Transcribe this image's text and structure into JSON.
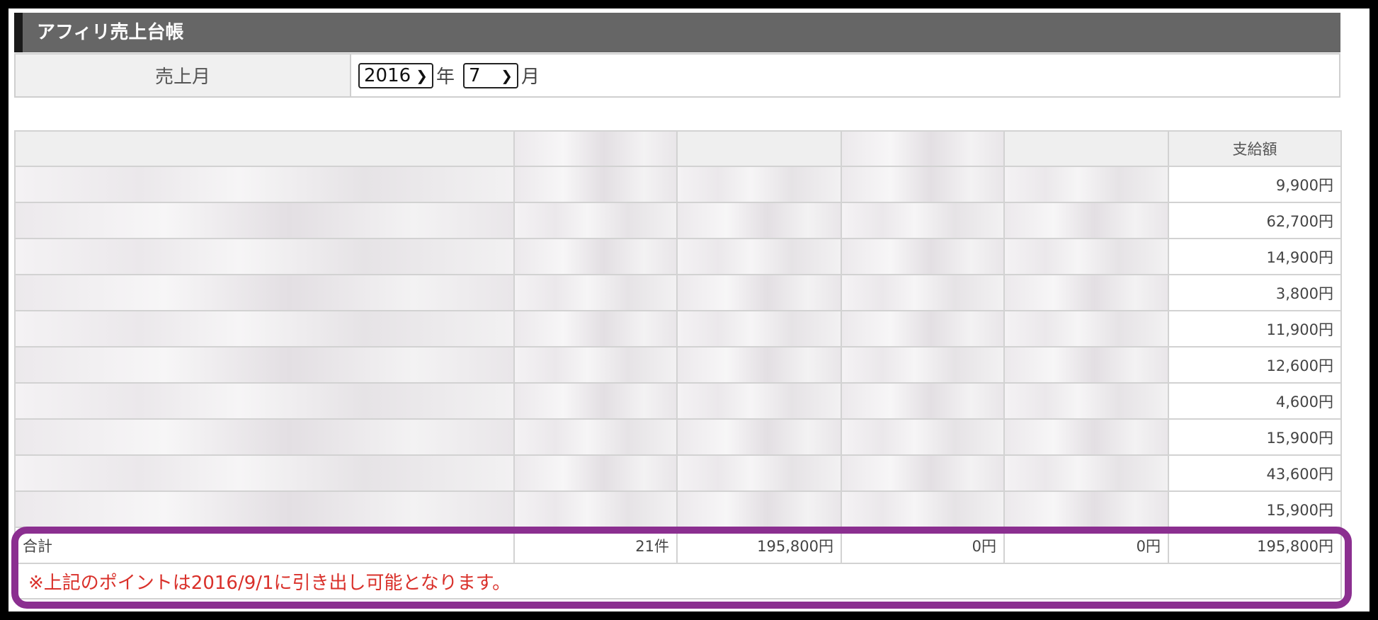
{
  "title": "アフィリ売上台帳",
  "month_selector": {
    "label": "売上月",
    "year_value": "2016",
    "year_unit": "年",
    "month_value": "7",
    "month_unit": "月"
  },
  "table": {
    "header_last": "支給額",
    "rows": [
      {
        "amount": "9,900円"
      },
      {
        "amount": "62,700円"
      },
      {
        "amount": "14,900円"
      },
      {
        "amount": "3,800円"
      },
      {
        "amount": "11,900円"
      },
      {
        "amount": "12,600円"
      },
      {
        "amount": "4,600円"
      },
      {
        "amount": "15,900円"
      },
      {
        "amount": "43,600円"
      },
      {
        "amount": "15,900円"
      }
    ],
    "total": {
      "label": "合計",
      "count": "21件",
      "col3": "195,800円",
      "col4": "0円",
      "col5": "0円",
      "amount": "195,800円"
    },
    "note": "※上記のポイントは2016/9/1に引き出し可能となります。"
  },
  "colors": {
    "title_bg": "#666666",
    "note_text": "#d9302a",
    "highlight": "#8b2f90"
  }
}
